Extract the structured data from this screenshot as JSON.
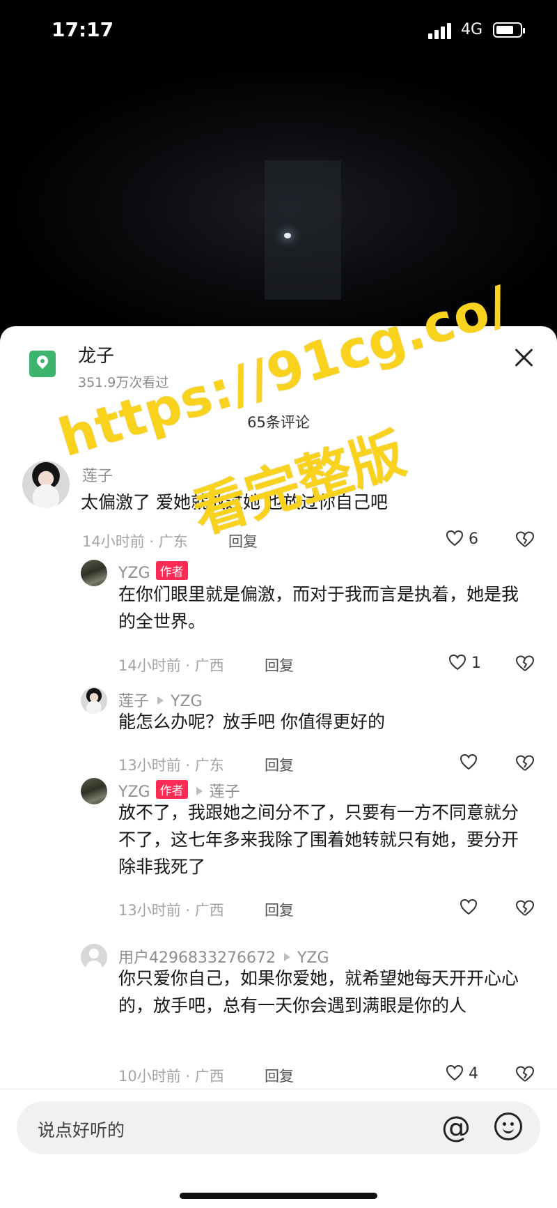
{
  "status": {
    "time": "17:17",
    "network": "4G"
  },
  "location": {
    "name": "龙子",
    "views": "351.9万次看过"
  },
  "comments_count": "65条评论",
  "comments": [
    {
      "user": "莲子",
      "text": "太偏激了 爱她就放过她 也放过你自己吧",
      "time_loc": "14小时前 · 广东",
      "reply": "回复",
      "likes": "6"
    },
    {
      "user": "YZG",
      "tag": "作者",
      "text": "在你们眼里就是偏激，而对于我而言是执着，她是我的全世界。",
      "time_loc": "14小时前 · 广西",
      "reply": "回复",
      "likes": "1"
    },
    {
      "user": "莲子",
      "to": "YZG",
      "text": "能怎么办呢？放手吧 你值得更好的",
      "time_loc": "13小时前 · 广东",
      "reply": "回复",
      "likes": ""
    },
    {
      "user": "YZG",
      "tag": "作者",
      "to": "莲子",
      "text": "放不了，我跟她之间分不了，只要有一方不同意就分不了，这七年多来我除了围着她转就只有她，要分开除非我死了",
      "time_loc": "13小时前 · 广西",
      "reply": "回复",
      "likes": ""
    },
    {
      "user": "用户4296833276672",
      "to": "YZG",
      "text": "你只爱你自己，如果你爱她，就希望她每天开开心心的，放手吧，总有一天你会遇到满眼是你的人",
      "time_loc": "10小时前 · 广西",
      "reply": "回复",
      "likes": "4"
    }
  ],
  "input": {
    "placeholder": "说点好听的",
    "at_symbol": "@"
  },
  "watermark": {
    "line1": "https://91cg.co/",
    "line2": "看完整版"
  },
  "colors": {
    "author_tag": "#fe2c55",
    "location_icon": "#3cb46e",
    "watermark": "#f8d21c"
  }
}
